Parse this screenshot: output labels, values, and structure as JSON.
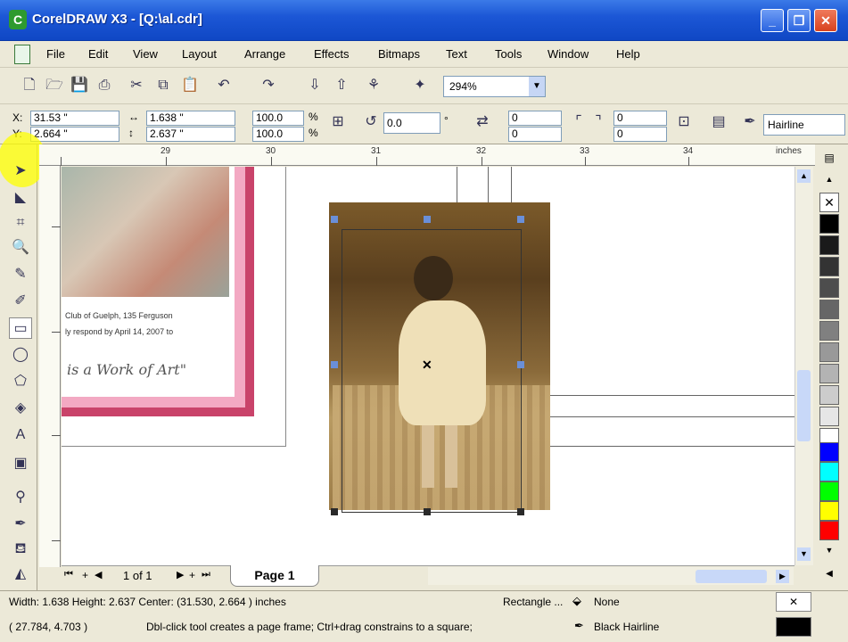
{
  "window": {
    "title": "CorelDRAW X3 - [Q:\\al.cdr]",
    "app_icon": "coreldraw-icon"
  },
  "menu": [
    "File",
    "Edit",
    "View",
    "Layout",
    "Arrange",
    "Effects",
    "Bitmaps",
    "Text",
    "Tools",
    "Window",
    "Help"
  ],
  "toolbar": {
    "zoom": "294%"
  },
  "props": {
    "x": "31.53 \"",
    "y": "2.664 \"",
    "w": "1.638 \"",
    "h": "2.637 \"",
    "sx": "100.0",
    "sy": "100.0",
    "pct1": "%",
    "pct2": "%",
    "rotation": "0.0",
    "deg": "°",
    "corner1": "0",
    "corner2": "0",
    "corner3": "0",
    "corner4": "0",
    "outline": "Hairline",
    "x_label": "X:",
    "y_label": "Y:"
  },
  "ruler": {
    "labels": [
      "29",
      "30",
      "31",
      "32",
      "33",
      "34"
    ],
    "units": "inches"
  },
  "canvas": {
    "card_text1": "Club of Guelph, 135 Ferguson",
    "card_text2": "ly respond by April 14, 2007 to",
    "card_script": "is a Work of Art\""
  },
  "pages": {
    "count": "1 of 1",
    "tab": "Page 1"
  },
  "status": {
    "dims": "Width: 1.638  Height: 2.637  Center: (31.530, 2.664 )  inches",
    "obj_type": "Rectangle ...",
    "fill": "None",
    "coords": "( 27.784, 4.703 )",
    "hint": "Dbl-click tool creates a page frame; Ctrl+drag constrains to a square;",
    "outline": "Black  Hairline"
  },
  "palette_colors": [
    "#ffffff",
    "#000000",
    "#1a1a1a",
    "#333333",
    "#4d4d4d",
    "#666666",
    "#808080",
    "#999999",
    "#b3b3b3",
    "#cccccc",
    "#e6e6e6",
    "#ffffff",
    "#0000ff",
    "#00ffff",
    "#00ff00",
    "#ffff00",
    "#ff0000"
  ]
}
